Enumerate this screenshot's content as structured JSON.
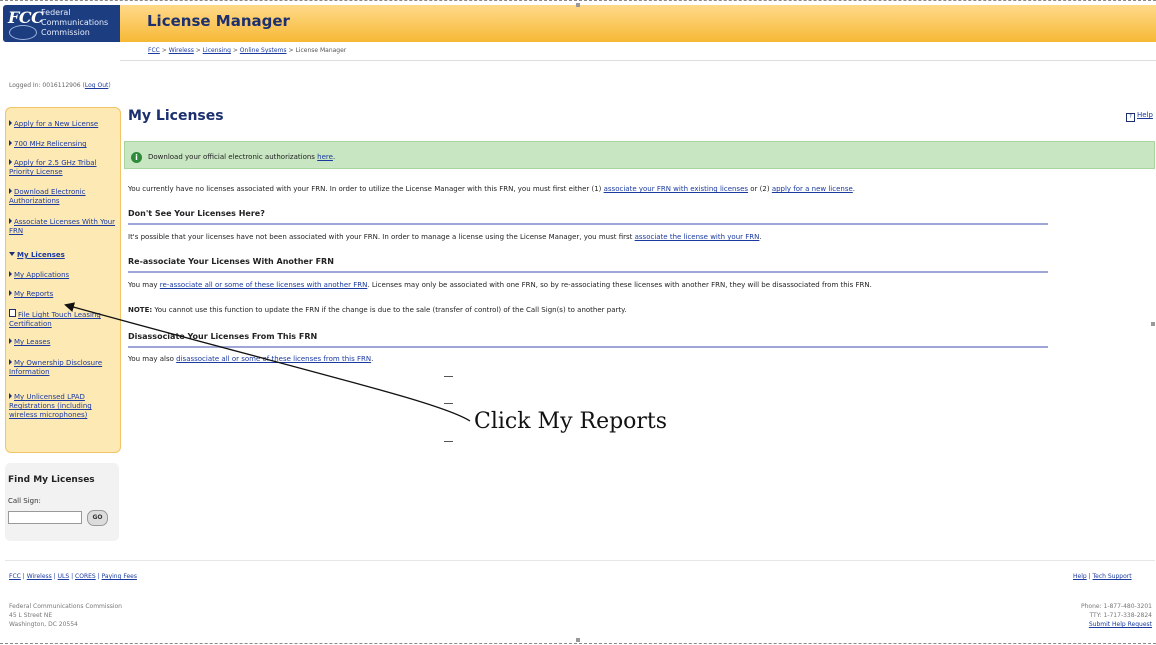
{
  "header": {
    "agency_short": "FCC",
    "agency_name_lines": [
      "Federal",
      "Communications",
      "Commission"
    ],
    "app_title": "License Manager",
    "breadcrumb": [
      "FCC",
      "Wireless",
      "Licensing",
      "Online Systems",
      "License Manager"
    ],
    "breadcrumb_sep": ">"
  },
  "session": {
    "logged_in_prefix": "Logged In: 0016112906 (",
    "logout_label": "Log Out",
    "logged_in_suffix": ")"
  },
  "sidebar": {
    "items": [
      {
        "label": "Apply for a New License"
      },
      {
        "label": "700 MHz Relicensing"
      },
      {
        "label": "Apply for 2.5 GHz Tribal Priority License"
      },
      {
        "label": "Download Electronic Authorizations"
      },
      {
        "label": "Associate Licenses With Your FRN"
      },
      {
        "label": "My Licenses"
      },
      {
        "label": "My Applications"
      },
      {
        "label": "My Reports"
      },
      {
        "label": "File Light Touch Leasing Certification"
      },
      {
        "label": "My Leases"
      },
      {
        "label": "My Ownership Disclosure Information"
      },
      {
        "label": "My Unlicensed LPAD Registrations (including wireless microphones)"
      }
    ],
    "find": {
      "title": "Find My Licenses",
      "call_sign_label": "Call Sign:",
      "call_sign_value": "",
      "go_label": "GO"
    }
  },
  "main": {
    "heading": "My Licenses",
    "help_label": "Help",
    "notice": {
      "text": "Download your official electronic authorizations ",
      "link": "here",
      "suffix": "."
    },
    "intro": {
      "text1": "You currently have no licenses associated with your FRN. In order to utilize the License Manager with this FRN, you must first either (1) ",
      "link1": "associate your FRN with existing licenses",
      "text2": " or (2) ",
      "link2": "apply for a new license",
      "text3": "."
    },
    "sections": [
      {
        "title": "Don't See Your Licenses Here?",
        "text1": "It's possible that your licenses have not been associated with your FRN. In order to manage a license using the License Manager, you must first ",
        "link": "associate the license with your FRN",
        "text2": "."
      },
      {
        "title": "Re-associate Your Licenses With Another FRN",
        "text1": "You may ",
        "link": "re-associate all or some of these licenses with another FRN",
        "text2": ". Licenses may only be associated with one FRN, so by re-associating these licenses with another FRN, they will be disassociated from this FRN.",
        "note_label": "NOTE:",
        "note_text": " You cannot use this function to update the FRN if the change is due to the sale (transfer of control) of the Call Sign(s) to another party."
      },
      {
        "title": "Disassociate Your Licenses From This FRN",
        "text1": "You may also ",
        "link": "disassociate all or some of these licenses from this FRN",
        "text2": "."
      }
    ],
    "callout": "Click My Reports"
  },
  "footer": {
    "links": [
      "FCC",
      "Wireless",
      "ULS",
      "CORES",
      "Paying Fees"
    ],
    "link_sep": " | ",
    "right_links": [
      "Help",
      "Tech Support"
    ],
    "address_lines": [
      "Federal Communications Commission",
      "45 L Street NE",
      "Washington, DC 20554"
    ],
    "phone": "Phone: 1-877-480-3201",
    "tty": "TTY: 1-717-338-2824",
    "submit_help": "Submit Help Request"
  }
}
